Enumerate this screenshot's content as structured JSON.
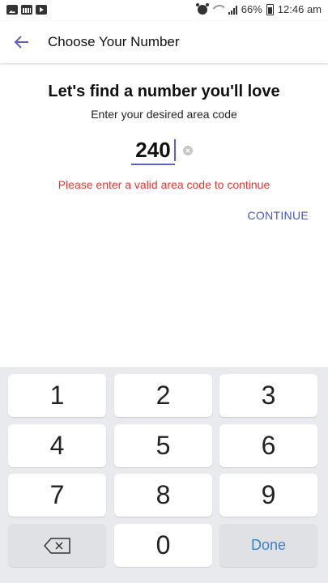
{
  "status_bar": {
    "battery": "66%",
    "time": "12:46 am",
    "left_icons": [
      "image-icon",
      "calendar-icon",
      "play-icon"
    ],
    "right_icons": [
      "alarm-icon",
      "wifi-icon",
      "signal-icon",
      "battery-icon"
    ]
  },
  "app_bar": {
    "title": "Choose Your Number",
    "back_icon": "arrow-left-icon"
  },
  "content": {
    "heading": "Let's find a number you'll love",
    "subheading": "Enter your desired area code",
    "area_code_value": "240",
    "error": "Please enter a valid area code to continue",
    "continue_label": "CONTINUE"
  },
  "keypad": {
    "keys": [
      "1",
      "2",
      "3",
      "4",
      "5",
      "6",
      "7",
      "8",
      "9",
      "0"
    ],
    "done_label": "Done",
    "backspace_icon": "backspace-icon"
  },
  "colors": {
    "accent": "#4a56c4",
    "error": "#e53935",
    "done_text": "#3b82c4",
    "keypad_bg": "#e8eaed"
  }
}
